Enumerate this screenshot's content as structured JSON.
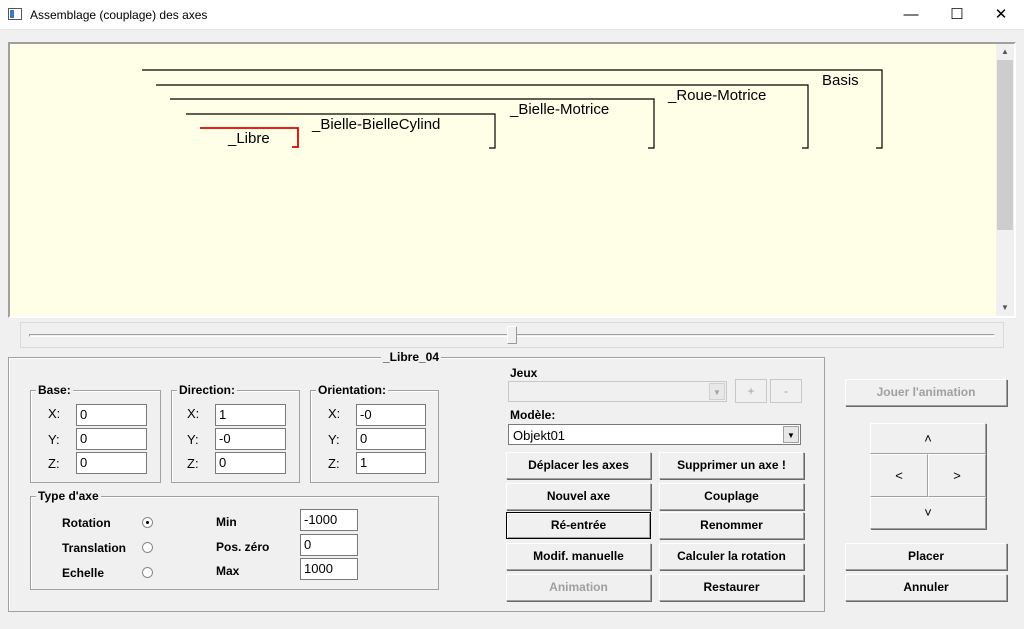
{
  "window": {
    "title": "Assemblage (couplage) des axes",
    "minimize": "—",
    "maximize": "☐",
    "close": "✕"
  },
  "tree": {
    "labels": [
      "Basis",
      "_Roue-Motrice",
      "_Bielle-Motrice",
      "_Bielle-BielleCylind",
      "_Libre"
    ],
    "selected_color": "#e00000"
  },
  "axis_panel": {
    "title": "_Libre_04",
    "base": {
      "label": "Base:",
      "x_label": "X:",
      "y_label": "Y:",
      "z_label": "Z:",
      "x": "0",
      "y": "0",
      "z": "0"
    },
    "direction": {
      "label": "Direction:",
      "x_label": "X:",
      "y_label": "Y:",
      "z_label": "Z:",
      "x": "1",
      "y": "-0",
      "z": "0"
    },
    "orientation": {
      "label": "Orientation:",
      "x_label": "X:",
      "y_label": "Y:",
      "z_label": "Z:",
      "x": "-0",
      "y": "0",
      "z": "1"
    },
    "type": {
      "label": "Type d'axe",
      "options": [
        "Rotation",
        "Translation",
        "Echelle"
      ],
      "selected": "Rotation",
      "min_label": "Min",
      "zero_label": "Pos. zéro",
      "max_label": "Max",
      "min": "-1000",
      "zero": "0",
      "max": "1000"
    }
  },
  "jeux": {
    "label": "Jeux",
    "value": "",
    "plus": "+",
    "minus": "-"
  },
  "modele": {
    "label": "Modèle:",
    "value": "Objekt01"
  },
  "buttons": {
    "deplacer": "Déplacer les axes",
    "supprimer": "Supprimer un axe !",
    "nouvel": "Nouvel axe",
    "couplage": "Couplage",
    "reentree": "Ré-entrée",
    "renommer": "Renommer",
    "modif": "Modif. manuelle",
    "calculer": "Calculer la rotation",
    "animation": "Animation",
    "restaurer": "Restaurer",
    "jouer": "Jouer l'animation",
    "placer": "Placer",
    "annuler": "Annuler"
  },
  "nav": {
    "up": "˄",
    "left": "<",
    "right": ">",
    "down": "˅"
  },
  "icons": {
    "scroll_up": "up-arrow-icon",
    "scroll_down": "down-arrow-icon",
    "dropdown": "chevron-down-icon",
    "radio_selected": "radio-on-icon"
  }
}
